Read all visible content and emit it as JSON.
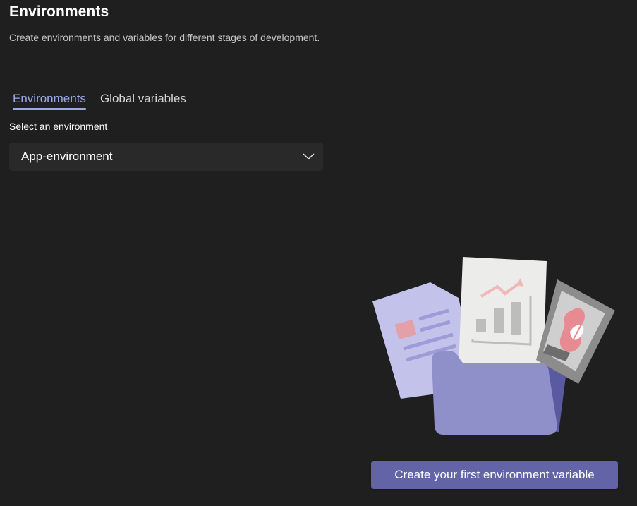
{
  "header": {
    "title": "Environments",
    "subtitle": "Create environments and variables for different stages of development."
  },
  "tabs": [
    {
      "label": "Environments",
      "active": true
    },
    {
      "label": "Global variables",
      "active": false
    }
  ],
  "environment_select": {
    "label": "Select an environment",
    "value": "App-environment",
    "icon": "chevron-down-icon"
  },
  "empty_state": {
    "illustration": "folder-with-documents-illustration",
    "cta_label": "Create your first environment variable"
  },
  "colors": {
    "background": "#1f1f1f",
    "accent": "#6264a7",
    "active_tab": "#9aa8ea"
  }
}
